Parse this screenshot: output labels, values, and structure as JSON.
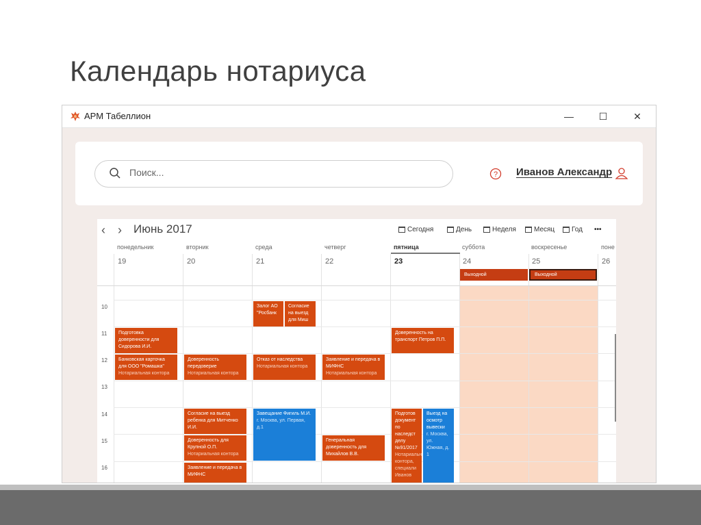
{
  "slide": {
    "title": "Календарь нотариуса"
  },
  "window": {
    "title": "АРМ Табеллион",
    "minimize": "—",
    "maximize": "☐",
    "close": "✕"
  },
  "header": {
    "search_placeholder": "Поиск...",
    "user_name": "Иванов Александр"
  },
  "calendar": {
    "month": "Июнь 2017",
    "toolbar": {
      "today": "Сегодня",
      "day": "День",
      "week": "Неделя",
      "month": "Месяц",
      "year": "Год",
      "more": "•••"
    },
    "days": [
      {
        "name": "понедельник",
        "num": "19"
      },
      {
        "name": "вторник",
        "num": "20"
      },
      {
        "name": "среда",
        "num": "21"
      },
      {
        "name": "четверг",
        "num": "22"
      },
      {
        "name": "пятница",
        "num": "23"
      },
      {
        "name": "суббота",
        "num": "24"
      },
      {
        "name": "воскресенье",
        "num": "25"
      },
      {
        "name": "поне",
        "num": "26"
      }
    ],
    "allday": {
      "sat": "Выходной",
      "sun": "Выходной"
    },
    "hours": [
      "10",
      "11",
      "12",
      "13",
      "14",
      "15",
      "16"
    ],
    "events": {
      "e1": {
        "title": "Подготовка доверенности для Сидорова И.И."
      },
      "e2": {
        "title": "Банковская карточка для ООО \"Ромашка\"",
        "sub": "Нотариальная контора"
      },
      "e3": {
        "title": "Доверенность передоверие",
        "sub": "Нотариальная контора"
      },
      "e4": {
        "title": "Согласие на выезд ребенка для Митченко И.И."
      },
      "e5": {
        "title": "Доверенность для Крупной О.П.",
        "sub": "Нотариальная контора"
      },
      "e6": {
        "title": "Заявление и передача в МИФНС"
      },
      "e7": {
        "title": "Залог АО \"Росбанк"
      },
      "e8": {
        "title": "Согласие на выезд для Миш"
      },
      "e9": {
        "title": "Отказ от наследства",
        "sub": "Нотариальная контора"
      },
      "e10": {
        "title": "Завещание Фигиль М.И.",
        "sub": "г. Москва, ул. Первая, д.1"
      },
      "e11": {
        "title": "Заявление и передача в МИФНС",
        "sub": "Нотариальная контора"
      },
      "e12": {
        "title": "Генеральная доверенность для Михайлов В.В."
      },
      "e13": {
        "title": "Доверенность на транспорт Петров П.П."
      },
      "e14": {
        "title": "Подготов документ по наследст делу №91/2017",
        "sub": "Нотариальная контора, специали Иванов"
      },
      "e15": {
        "title": "Выезд на осмотр вывески",
        "sub": "г. Москва, ул. Южная, д. 1"
      }
    }
  },
  "colors": {
    "accent": "#d54a10",
    "blue": "#1b7fd8",
    "weekend": "#fbd9c4",
    "window_bg": "#f3ece9"
  }
}
